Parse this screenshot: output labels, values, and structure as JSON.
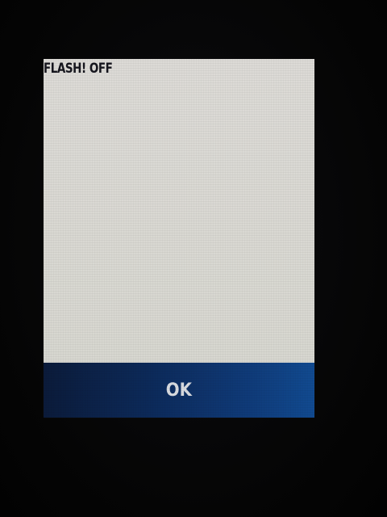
{
  "screen": {
    "status_text": "FLASH! OFF"
  },
  "softkeys": {
    "ok_label": "OK"
  },
  "colors": {
    "screen_background": "#dcdad6",
    "softkey_bar": "#0f3a78",
    "text": "#16161e",
    "softkey_text": "#d8dbe0"
  }
}
